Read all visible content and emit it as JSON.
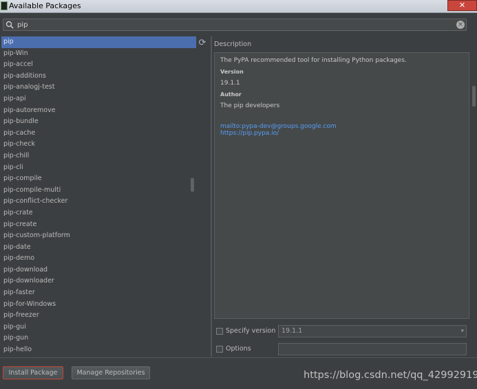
{
  "window": {
    "title": "Available Packages",
    "close_glyph": "✕"
  },
  "search": {
    "value": "pip",
    "icon": "search-icon",
    "clear_glyph": "×"
  },
  "packages": [
    "pip",
    "pip-Win",
    "pip-accel",
    "pip-additions",
    "pip-analogj-test",
    "pip-api",
    "pip-autoremove",
    "pip-bundle",
    "pip-cache",
    "pip-check",
    "pip-chill",
    "pip-cli",
    "pip-compile",
    "pip-compile-multi",
    "pip-conflict-checker",
    "pip-crate",
    "pip-create",
    "pip-custom-platform",
    "pip-date",
    "pip-demo",
    "pip-download",
    "pip-downloader",
    "pip-faster",
    "pip-for-Windows",
    "pip-freezer",
    "pip-gui",
    "pip-gun",
    "pip-hello"
  ],
  "selected_package": "pip",
  "refresh_glyph": "⟳",
  "description": {
    "label": "Description",
    "summary": "The PyPA recommended tool for installing Python packages.",
    "version_heading": "Version",
    "version": "19.1.1",
    "author_heading": "Author",
    "author": "The pip developers",
    "links": [
      "mailto:pypa-dev@groups.google.com",
      "https://pip.pypa.io/"
    ]
  },
  "specify_version": {
    "label": "Specify version",
    "checked": false,
    "value": "19.1.1",
    "arrow": "▾"
  },
  "options": {
    "label": "Options",
    "checked": false,
    "value": ""
  },
  "buttons": {
    "install": "Install Package",
    "manage": "Manage Repositories"
  },
  "watermark": "https://blog.csdn.net/qq_42992919",
  "colors": {
    "selection": "#4b6eaf",
    "link": "#589df6",
    "install_border": "#c3473a"
  }
}
